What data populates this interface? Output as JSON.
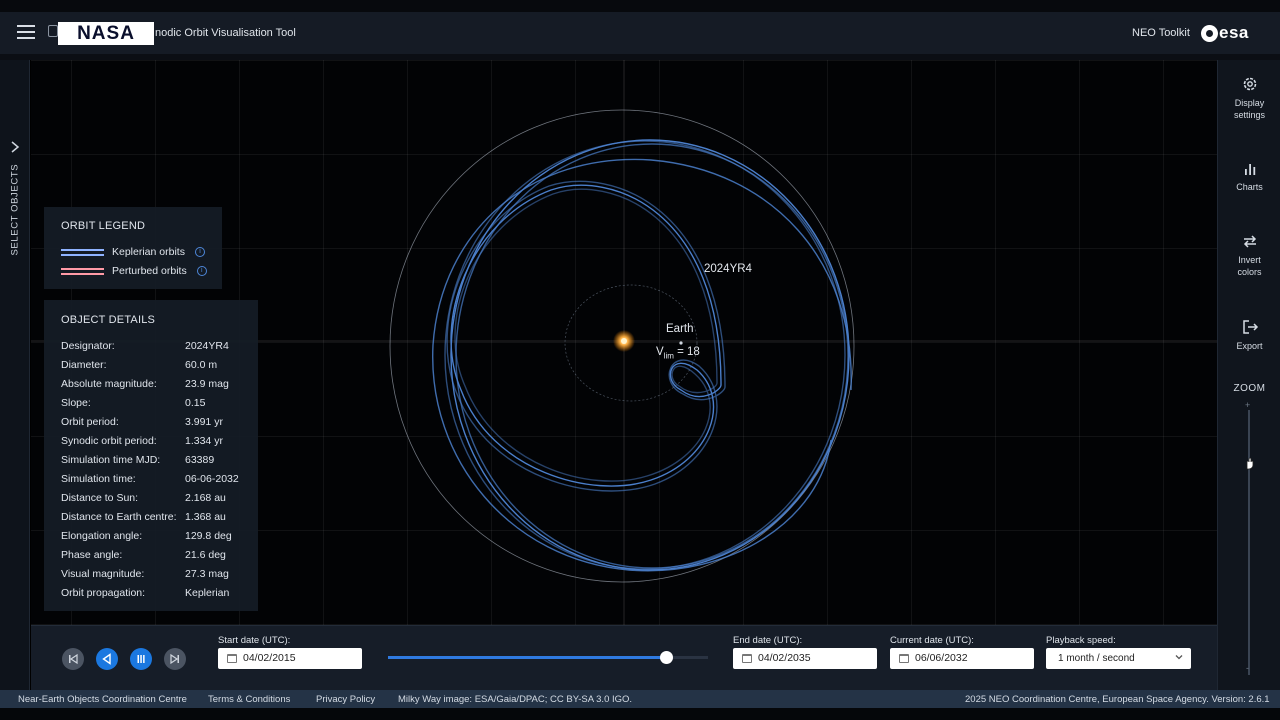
{
  "header": {
    "logo_text": "NASA",
    "app_title": "nodic Orbit Visualisation Tool",
    "neo_toolkit": "NEO Toolkit",
    "esa_logo_text": "esa"
  },
  "left_rail": {
    "select_objects": "SELECT OBJECTS"
  },
  "scene": {
    "asteroid_label": "2024YR4",
    "earth_label": "Earth",
    "vinf_prefix": "V",
    "vinf_sub": "lim",
    "vinf_value": " = 18",
    "colors": {
      "keplerian": "#4f86d6",
      "sun": "#ffb347",
      "ring": "#b9c2cf"
    }
  },
  "legend": {
    "title": "ORBIT LEGEND",
    "items": [
      {
        "label": "Keplerian orbits",
        "color": "#8fb3ff"
      },
      {
        "label": "Perturbed orbits",
        "color": "#ff9aa6"
      }
    ]
  },
  "details": {
    "title": "OBJECT DETAILS",
    "rows": [
      {
        "k": "Designator:",
        "v": "2024YR4"
      },
      {
        "k": "Diameter:",
        "v": "60.0 m"
      },
      {
        "k": "Absolute magnitude:",
        "v": "23.9 mag"
      },
      {
        "k": "Slope:",
        "v": "0.15"
      },
      {
        "k": "Orbit period:",
        "v": "3.991 yr"
      },
      {
        "k": "Synodic orbit period:",
        "v": "1.334 yr"
      },
      {
        "k": "Simulation time MJD:",
        "v": "63389"
      },
      {
        "k": "Simulation time:",
        "v": "06-06-2032"
      },
      {
        "k": "Distance to Sun:",
        "v": "2.168 au"
      },
      {
        "k": "Distance to Earth centre:",
        "v": "1.368 au"
      },
      {
        "k": "Elongation angle:",
        "v": "129.8 deg"
      },
      {
        "k": "Phase angle:",
        "v": "21.6 deg"
      },
      {
        "k": "Visual magnitude:",
        "v": "27.3 mag"
      },
      {
        "k": "Orbit propagation:",
        "v": "Keplerian"
      }
    ]
  },
  "right_rail": {
    "display_settings": [
      "Display",
      "settings"
    ],
    "charts": "Charts",
    "invert_colors": [
      "Invert",
      "colors"
    ],
    "export": "Export",
    "zoom": "ZOOM",
    "zoom_plus": "+",
    "zoom_minus": "-"
  },
  "controls": {
    "start_label": "Start date (UTC):",
    "start_value": "04/02/2015",
    "end_label": "End date (UTC):",
    "end_value": "04/02/2035",
    "current_label": "Current date (UTC):",
    "current_value": "06/06/2032",
    "speed_label": "Playback speed:",
    "speed_value": "1 month / second",
    "timeline_progress": 0.87,
    "zoom_level": 0.2
  },
  "footer": {
    "neocc": "Near-Earth Objects Coordination Centre",
    "terms": "Terms & Conditions",
    "privacy": "Privacy Policy",
    "milkyway": "Milky Way image: ESA/Gaia/DPAC; CC BY-SA 3.0 IGO.",
    "copyright": "2025 NEO Coordination Centre, European Space Agency. Version: 2.6.1"
  }
}
